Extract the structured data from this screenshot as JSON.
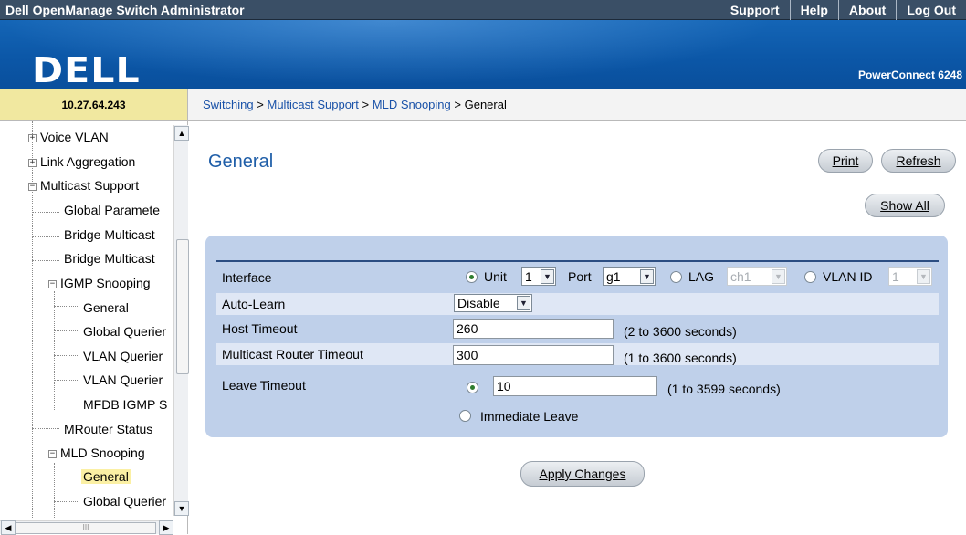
{
  "app": {
    "title": "Dell OpenManage Switch Administrator"
  },
  "top_links": [
    "Support",
    "Help",
    "About",
    "Log Out"
  ],
  "header": {
    "logo": "DELL",
    "product": "PowerConnect 6248"
  },
  "ip_address": "10.27.64.243",
  "breadcrumb": {
    "items": [
      "Switching",
      "Multicast Support",
      "MLD Snooping"
    ],
    "current": "General",
    "separator": ">"
  },
  "sidebar": {
    "voice_vlan": "Voice VLAN",
    "link_aggregation": "Link Aggregation",
    "multicast_support": "Multicast Support",
    "global_parameters": "Global Paramete",
    "bridge_multicast_1": "Bridge Multicast",
    "bridge_multicast_2": "Bridge Multicast",
    "igmp_snooping": "IGMP Snooping",
    "igmp_general": "General",
    "igmp_global_querier": "Global Querier",
    "igmp_vlan_querier_1": "VLAN Querier",
    "igmp_vlan_querier_2": "VLAN Querier",
    "mfdb_igmp": "MFDB IGMP S",
    "mrouter_status": "MRouter Status",
    "mld_snooping": "MLD Snooping",
    "mld_general": "General",
    "mld_global_querier": "Global Querier"
  },
  "page": {
    "title": "General",
    "print": "Print",
    "refresh": "Refresh",
    "show_all": "Show All",
    "apply": "Apply Changes"
  },
  "form": {
    "interface": {
      "label": "Interface",
      "unit_label": "Unit",
      "unit_value": "1",
      "port_label": "Port",
      "port_value": "g1",
      "lag_label": "LAG",
      "lag_value": "ch1",
      "vlan_label": "VLAN ID",
      "vlan_value": "1",
      "selected": "Unit"
    },
    "auto_learn": {
      "label": "Auto-Learn",
      "value": "Disable"
    },
    "host_timeout": {
      "label": "Host Timeout",
      "value": "260",
      "hint": "(2 to 3600 seconds)"
    },
    "mrouter_timeout": {
      "label": "Multicast Router Timeout",
      "value": "300",
      "hint": "(1 to 3600 seconds)"
    },
    "leave_timeout": {
      "label": "Leave Timeout",
      "value": "10",
      "hint": "(1 to 3599 seconds)",
      "immediate_label": "Immediate Leave",
      "selected": "value"
    }
  }
}
